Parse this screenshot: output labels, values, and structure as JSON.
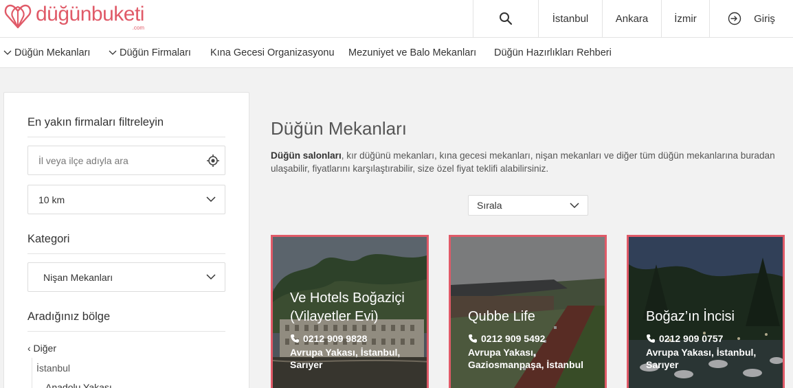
{
  "header": {
    "logo": "düğünbuketi",
    "logo_suffix": ".com",
    "cities": [
      "İstanbul",
      "Ankara",
      "İzmir"
    ],
    "login_label": "Giriş"
  },
  "nav": [
    {
      "label": "Düğün Mekanları",
      "has_dropdown": true
    },
    {
      "label": "Düğün Firmaları",
      "has_dropdown": true
    },
    {
      "label": "Kına Gecesi Organizasyonu",
      "has_dropdown": false
    },
    {
      "label": "Mezuniyet ve Balo Mekanları",
      "has_dropdown": false
    },
    {
      "label": "Düğün Hazırlıkları Rehberi",
      "has_dropdown": false
    }
  ],
  "sidebar": {
    "filter_title": "En yakın firmaları filtreleyin",
    "location_placeholder": "İl veya ilçe adıyla ara",
    "distance_value": "10 km",
    "category_title": "Kategori",
    "category_value": "Nişan Mekanları",
    "region_title": "Aradığınız bölge",
    "region_back": "‹ Diğer",
    "region_city": "İstanbul",
    "region_sub": "Anadolu Yakası"
  },
  "main": {
    "title": "Düğün Mekanları",
    "desc_bold": "Düğün salonları",
    "desc_rest": ", kır düğünü mekanları, kına gecesi mekanları, nişan mekanları ve diğer tüm düğün mekanlarına buradan ulaşabilir, fiyatlarını karşılaştırabilir, size özel fiyat teklifi alabilirsiniz.",
    "sort_label": "Sırala"
  },
  "venues": [
    {
      "name": "Ve Hotels Boğaziçi (Vilayetler Evi)",
      "phone": "0212 909 9828",
      "location": "Avrupa Yakası, İstanbul, Sarıyer"
    },
    {
      "name": "Qubbe Life",
      "phone": "0212 909 5492",
      "location": "Avrupa Yakası, Gaziosmanpaşa, İstanbul"
    },
    {
      "name": "Boğaz’ın İncisi",
      "phone": "0212 909 0757",
      "location": "Avrupa Yakası, İstanbul, Sarıyer"
    }
  ],
  "colors": {
    "brand": "#e05a68",
    "brand_dark": "#c73a4b"
  }
}
